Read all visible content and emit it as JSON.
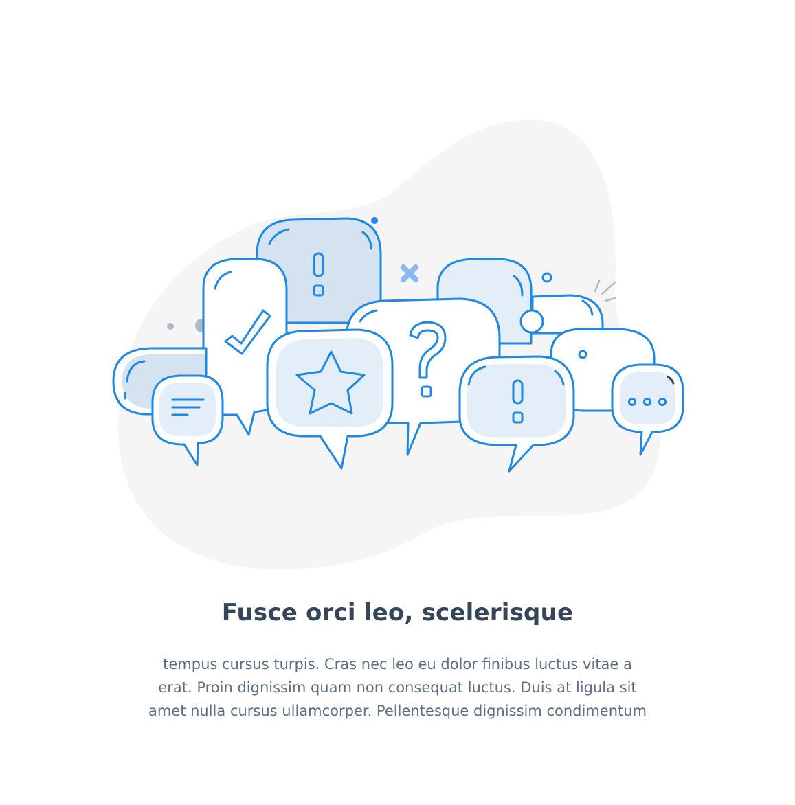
{
  "title": "Fusce orci leo, scelerisque",
  "body_lines": [
    "tempus cursus turpis. Cras nec leo eu dolor finibus luctus vitae a",
    "erat. Proin dignissim quam non consequat luctus. Duis at ligula sit",
    "amet nulla cursus ullamcorper. Pellentesque dignissim condimentum"
  ],
  "colors": {
    "stroke": "#1e88e5",
    "fill_light": "#e3eef9",
    "fill_mid": "#d5e3f0",
    "blob": "#f5f5f5",
    "dot_gray": "#b0b8c6",
    "x_mark": "#8ab8f5",
    "title": "#364659",
    "text": "#5b6f86"
  },
  "icons": [
    "checkmark-icon",
    "exclamation-icon",
    "question-icon",
    "star-icon",
    "text-lines-icon",
    "ellipsis-icon",
    "x-mark-icon"
  ]
}
